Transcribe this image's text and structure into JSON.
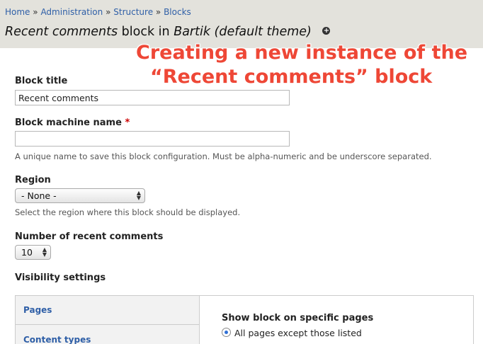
{
  "breadcrumb": {
    "items": [
      "Home",
      "Administration",
      "Structure",
      "Blocks"
    ],
    "separator": "»"
  },
  "title": {
    "block_name": "Recent comments",
    "middle": "block in",
    "theme": "Bartik (default theme)"
  },
  "annotation": {
    "line1": "Creating a new instance of the",
    "line2": "“Recent comments” block",
    "color": "#ee4736"
  },
  "form": {
    "block_title": {
      "label": "Block title",
      "value": "Recent comments"
    },
    "machine_name": {
      "label": "Block machine name",
      "required_mark": "*",
      "value": "",
      "description": "A unique name to save this block configuration. Must be alpha-numeric and be underscore separated."
    },
    "region": {
      "label": "Region",
      "selected": "- None -",
      "description": "Select the region where this block should be displayed."
    },
    "recent_count": {
      "label": "Number of recent comments",
      "selected": "10"
    },
    "visibility": {
      "heading": "Visibility settings",
      "tabs": [
        "Pages",
        "Content types"
      ],
      "pane_title": "Show block on specific pages",
      "radio_label": "All pages except those listed"
    }
  },
  "colors": {
    "link": "#2f5fa7",
    "header_bg": "#e3e2dc",
    "required": "#cc0000"
  }
}
